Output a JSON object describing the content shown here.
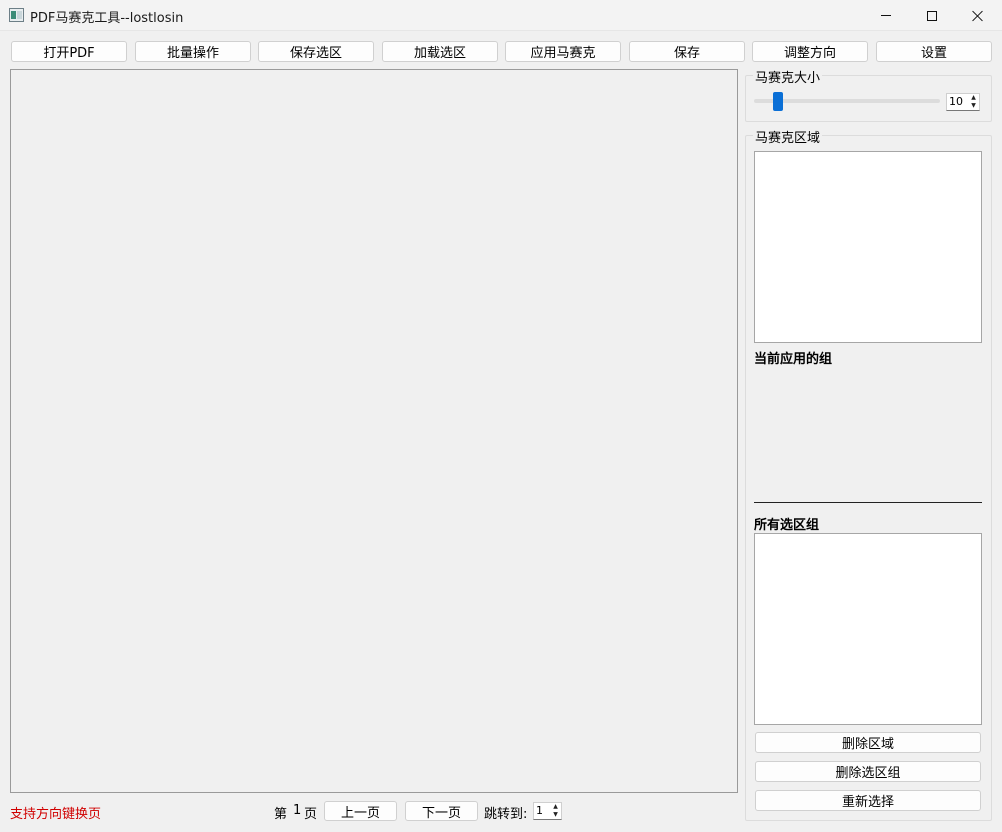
{
  "window": {
    "title": "PDF马赛克工具--lostlosin"
  },
  "toolbar": {
    "open_pdf": "打开PDF",
    "batch": "批量操作",
    "save_selection": "保存选区",
    "load_selection": "加载选区",
    "apply_mosaic": "应用马赛克",
    "save": "保存",
    "adjust_orientation": "调整方向",
    "settings": "设置"
  },
  "mosaic_size": {
    "title": "马赛克大小",
    "value": "10",
    "slider_level": 10
  },
  "mosaic_area": {
    "title": "马赛克区域",
    "current_group_label": "当前应用的组",
    "all_groups_label": "所有选区组",
    "delete_area": "删除区域",
    "delete_group": "删除选区组",
    "reselect": "重新选择"
  },
  "footer": {
    "hint": "支持方向键换页",
    "page_prefix": "第",
    "page_number": "1",
    "page_suffix": "页",
    "prev_page": "上一页",
    "next_page": "下一页",
    "jump_label": "跳转到:",
    "jump_value": "1"
  },
  "colors": {
    "accent": "#0a6fd6",
    "hint": "#d00000",
    "background": "#f0f0f0"
  },
  "icons": {
    "app": "app-icon",
    "minimize": "minimize-icon",
    "maximize": "maximize-icon",
    "close": "close-icon"
  }
}
